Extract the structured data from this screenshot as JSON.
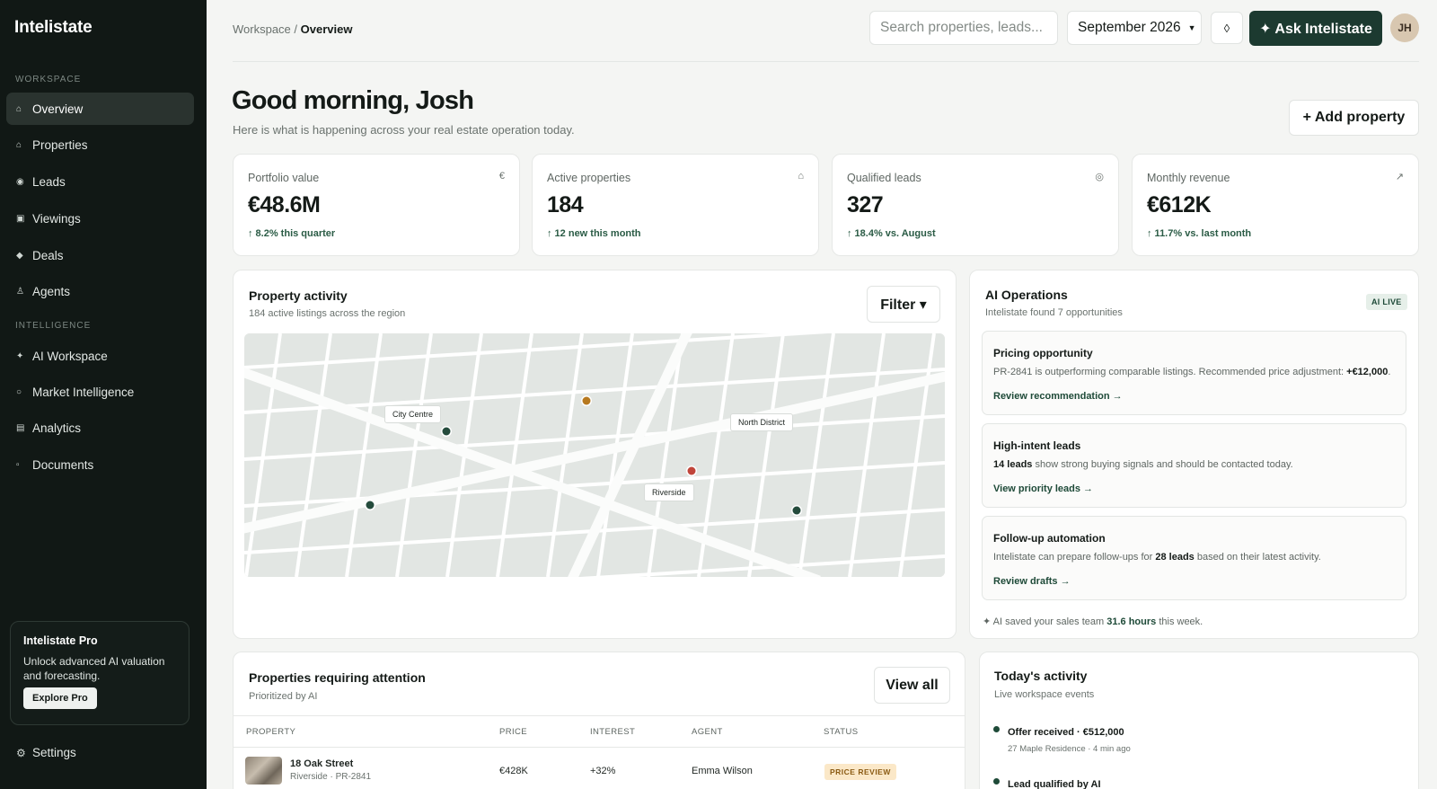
{
  "app": {
    "name": "Intelistate"
  },
  "sidebar": {
    "sections": {
      "workspace": "WORKSPACE",
      "intelligence": "INTELLIGENCE"
    },
    "items": [
      {
        "label": "Overview",
        "icon": "home-icon",
        "glyph": "⌂"
      },
      {
        "label": "Properties",
        "icon": "building-icon",
        "glyph": "⌂"
      },
      {
        "label": "Leads",
        "icon": "target-icon",
        "glyph": "◉"
      },
      {
        "label": "Viewings",
        "icon": "calendar-icon",
        "glyph": "▣"
      },
      {
        "label": "Deals",
        "icon": "diamond-icon",
        "glyph": "◆"
      },
      {
        "label": "Agents",
        "icon": "person-icon",
        "glyph": "♙"
      },
      {
        "label": "AI Workspace",
        "icon": "sparkle-icon",
        "glyph": "✦"
      },
      {
        "label": "Market Intelligence",
        "icon": "circle-icon",
        "glyph": "○"
      },
      {
        "label": "Analytics",
        "icon": "chart-icon",
        "glyph": "▤"
      },
      {
        "label": "Documents",
        "icon": "document-icon",
        "glyph": "▫"
      }
    ],
    "promo": {
      "title": "Intelistate Pro",
      "text": "Unlock advanced AI valuation and forecasting.",
      "button": "Explore Pro"
    },
    "settings": {
      "label": "Settings",
      "glyph": "⚙"
    }
  },
  "header": {
    "breadcrumb_root": "Workspace",
    "breadcrumb_sep": " / ",
    "breadcrumb_current": "Overview",
    "search_placeholder": "Search properties, leads...",
    "month": "September 2026",
    "ask_button": "✦ Ask Intelistate",
    "avatar_initials": "JH"
  },
  "page": {
    "greeting": "Good morning, Josh",
    "subtitle": "Here is what is happening across your real estate operation today.",
    "add_button": "+ Add property"
  },
  "kpis": [
    {
      "label": "Portfolio value",
      "icon": "€",
      "value": "€48.6M",
      "delta": "↑ 8.2% this quarter"
    },
    {
      "label": "Active properties",
      "icon": "⌂",
      "value": "184",
      "delta": "↑ 12 new this month"
    },
    {
      "label": "Qualified leads",
      "icon": "◎",
      "value": "327",
      "delta": "↑ 18.4% vs. August"
    },
    {
      "label": "Monthly revenue",
      "icon": "↗",
      "value": "€612K",
      "delta": "↑ 11.7% vs. last month"
    }
  ],
  "activity_map": {
    "title": "Property activity",
    "subtitle": "184 active listings across the region",
    "filter": "Filter ▾",
    "labels": {
      "city_centre": "City Centre",
      "north_district": "North District",
      "riverside": "Riverside"
    },
    "colors": {
      "green": "#244b3c",
      "amber": "#b7791f",
      "red": "#c0453a"
    }
  },
  "ai_ops": {
    "title": "AI Operations",
    "subtitle": "Intelistate found 7 opportunities",
    "badge": "AI LIVE",
    "items": [
      {
        "title": "Pricing opportunity",
        "pre": "PR-2841 is outperforming comparable listings. Recommended price adjustment: ",
        "bold": "+€12,000",
        "post": ".",
        "link": "Review recommendation →"
      },
      {
        "title": "High-intent leads",
        "pre": "",
        "bold": "14 leads",
        "post": " show strong buying signals and should be contacted today.",
        "link": "View priority leads →"
      },
      {
        "title": "Follow-up automation",
        "pre": "Intelistate can prepare follow-ups for ",
        "bold": "28 leads",
        "post": " based on their latest activity.",
        "link": "Review drafts →"
      }
    ],
    "footer_pre": "✦ AI saved your sales team ",
    "footer_bold": "31.6 hours",
    "footer_post": " this week."
  },
  "attention": {
    "title": "Properties requiring attention",
    "subtitle": "Prioritized by AI",
    "view_all": "View all",
    "columns": [
      "PROPERTY",
      "PRICE",
      "INTEREST",
      "AGENT",
      "STATUS"
    ],
    "rows": [
      {
        "name": "18 Oak Street",
        "meta": "Riverside · PR-2841",
        "price": "€428K",
        "interest": "+32%",
        "agent": "Emma Wilson",
        "status": "PRICE REVIEW"
      }
    ]
  },
  "today": {
    "title": "Today's activity",
    "subtitle": "Live workspace events",
    "events": [
      {
        "title": "Offer received · €512,000",
        "meta": "27 Maple Residence · 4 min ago"
      },
      {
        "title": "Lead qualified by AI",
        "meta": ""
      }
    ]
  }
}
